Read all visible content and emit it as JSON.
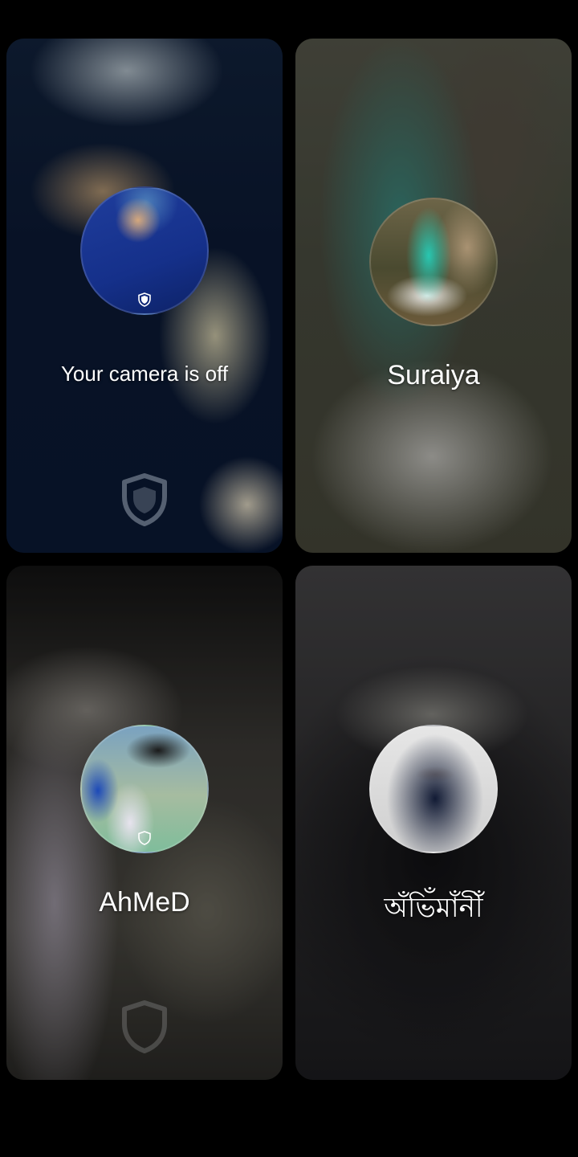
{
  "participants": [
    {
      "label": "Your camera is off",
      "avatar_desc": "self-avatar",
      "shield_icon": "shield-icon"
    },
    {
      "label": "Suraiya",
      "avatar_desc": "participant-avatar"
    },
    {
      "label": "AhMeD",
      "avatar_desc": "participant-avatar",
      "shield_icon": "shield-icon"
    },
    {
      "label": "অঁভিঁমাঁনীঁ",
      "avatar_desc": "participant-avatar"
    }
  ],
  "colors": {
    "background": "#000000",
    "text": "#ffffff"
  }
}
